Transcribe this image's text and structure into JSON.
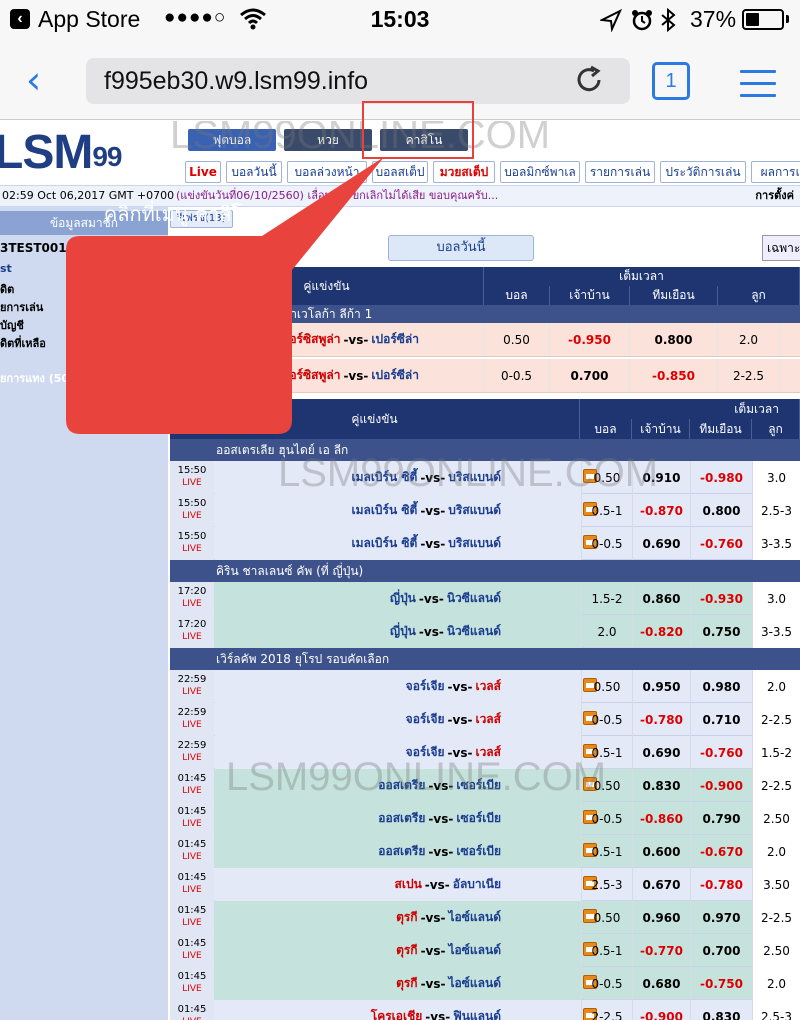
{
  "status": {
    "app": "App Store",
    "signal": "●●●●○",
    "time": "15:03",
    "battery": "37%"
  },
  "browser": {
    "url": "f995eb30.w9.lsm99.info",
    "tab_count": "1"
  },
  "site": {
    "logo": "LSM",
    "logo_num": "99",
    "nav_top": [
      "ฟุตบอล",
      "หวย",
      "คาสิโน"
    ],
    "nav_sub": [
      "Live",
      "บอลวันนี้",
      "บอลล่วงหน้า",
      "บอลสเต็ป",
      "มวยสเต็ป",
      "บอลมิกซ์พาเล",
      "รายการเล่น",
      "ประวัติการเล่น",
      "ผลการแข่"
    ],
    "clock": "02:59 Oct 06,2017 GMT +0700",
    "marquee": "(แข่งขันวันที่06/10/2560) เลื่อนก...                ยกเลิกไม่ได้เสีย ขอบคุณครับ...",
    "settings": "การตั้งค่",
    "sidebar": {
      "head": "ข้อมูลสมาชิก",
      "user": "3TEST001",
      "links": [
        "st",
        "ดิต",
        "ยการเล่น",
        "บัญชี",
        "ดิตที่เหลือ"
      ],
      "pending": "ยการแทง (50"
    },
    "refresh": "รีเฟรช(13)",
    "today_button": "บอลวันนี้",
    "only_select": "เฉพาะ",
    "watermark": "LSM99ONLINE.COM",
    "callout": "คลิกที่เมนู คาสิโน"
  },
  "table1": {
    "headers": {
      "match": "คู่แข่งขัน",
      "fulltime": "เต็มเวลา",
      "hdp": "บอล",
      "home": "เจ้าบ้าน",
      "away": "ทีมเยือน",
      "ou": "ลูก"
    },
    "league": "ค ทราเวโลก้า ลีก้า 1",
    "rows": [
      {
        "home": "เปอร์ซิสพูล่า",
        "vs": "-vs-",
        "away": "เปอร์ซีล่า",
        "hdp": "0.50",
        "h": "-0.950",
        "a": "0.800",
        "ou": "2.0"
      },
      {
        "home": "เปอร์ซิสพูล่า",
        "vs": "-vs-",
        "away": "เปอร์ซีล่า",
        "hdp": "0-0.5",
        "h": "0.700",
        "a": "-0.850",
        "ou": "2-2.5"
      }
    ]
  },
  "table2": {
    "headers": {
      "match": "คู่แข่งขัน",
      "fulltime": "เต็มเวลา",
      "hdp": "บอล",
      "home": "เจ้าบ้าน",
      "away": "ทีมเยือน",
      "ou": "ลูก"
    },
    "live_label": "LIVE",
    "sections": [
      {
        "league": "ออสเตรเลีย ฮุนไดย์ เอ ลีก",
        "color": "#e4e9f8",
        "rows": [
          {
            "time": "15:50",
            "home": "เมลเบิร์น ซิตี้",
            "away": "บริสแบนด์",
            "hdp": "0.50",
            "h": "0.910",
            "a": "-0.980",
            "ou": "3.0"
          },
          {
            "time": "15:50",
            "home": "เมลเบิร์น ซิตี้",
            "away": "บริสแบนด์",
            "hdp": "0.5-1",
            "h": "-0.870",
            "a": "0.800",
            "ou": "2.5-3"
          },
          {
            "time": "15:50",
            "home": "เมลเบิร์น ซิตี้",
            "away": "บริสแบนด์",
            "hdp": "0-0.5",
            "h": "0.690",
            "a": "-0.760",
            "ou": "3-3.5"
          }
        ]
      },
      {
        "league": "คิริน ชาลเลนซ์ คัพ (ที่ ญี่ปุ่น)",
        "color": "#c5e3dc",
        "rows": [
          {
            "time": "17:20",
            "home": "ญี่ปุ่น",
            "away": "นิวซีแลนด์",
            "hdp": "1.5-2",
            "h": "0.860",
            "a": "-0.930",
            "ou": "3.0"
          },
          {
            "time": "17:20",
            "home": "ญี่ปุ่น",
            "away": "นิวซีแลนด์",
            "hdp": "2.0",
            "h": "-0.820",
            "a": "0.750",
            "ou": "3-3.5"
          }
        ]
      },
      {
        "league": "เวิร์ลคัพ 2018 ยุโรป รอบคัดเลือก",
        "color": "#e4e9f8",
        "rows": [
          {
            "time": "22:59",
            "home": "จอร์เจีย",
            "away": "เวลส์",
            "hdp": "0.50",
            "h": "0.950",
            "a": "0.980",
            "ou": "2.0",
            "red_away": true
          },
          {
            "time": "22:59",
            "home": "จอร์เจีย",
            "away": "เวลส์",
            "hdp": "0-0.5",
            "h": "-0.780",
            "a": "0.710",
            "ou": "2-2.5",
            "red_away": true
          },
          {
            "time": "22:59",
            "home": "จอร์เจีย",
            "away": "เวลส์",
            "hdp": "0.5-1",
            "h": "0.690",
            "a": "-0.760",
            "ou": "1.5-2",
            "red_away": true
          },
          {
            "time": "01:45",
            "home": "ออสเตรีย",
            "away": "เซอร์เบีย",
            "hdp": "0.50",
            "h": "0.830",
            "a": "-0.900",
            "ou": "2-2.5",
            "green": true
          },
          {
            "time": "01:45",
            "home": "ออสเตรีย",
            "away": "เซอร์เบีย",
            "hdp": "0-0.5",
            "h": "-0.860",
            "a": "0.790",
            "ou": "2.50",
            "green": true
          },
          {
            "time": "01:45",
            "home": "ออสเตรีย",
            "away": "เซอร์เบีย",
            "hdp": "0.5-1",
            "h": "0.600",
            "a": "-0.670",
            "ou": "2.0",
            "green": true
          },
          {
            "time": "01:45",
            "home": "สเปน",
            "away": "อัลบาเนีย",
            "hdp": "2.5-3",
            "h": "0.670",
            "a": "-0.780",
            "ou": "3.50",
            "red_home": true
          },
          {
            "time": "01:45",
            "home": "ตุรกี",
            "away": "ไอซ์แลนด์",
            "hdp": "0.50",
            "h": "0.960",
            "a": "0.970",
            "ou": "2-2.5",
            "red_home": true,
            "green": true
          },
          {
            "time": "01:45",
            "home": "ตุรกี",
            "away": "ไอซ์แลนด์",
            "hdp": "0.5-1",
            "h": "-0.770",
            "a": "0.700",
            "ou": "2.50",
            "red_home": true,
            "green": true
          },
          {
            "time": "01:45",
            "home": "ตุรกี",
            "away": "ไอซ์แลนด์",
            "hdp": "0-0.5",
            "h": "0.680",
            "a": "-0.750",
            "ou": "2.0",
            "red_home": true,
            "green": true
          },
          {
            "time": "01:45",
            "home": "โครเอเชีย",
            "away": "ฟินแลนด์",
            "hdp": "2-2.5",
            "h": "-0.900",
            "a": "0.830",
            "ou": "2.5-3",
            "red_home": true
          }
        ]
      }
    ]
  }
}
